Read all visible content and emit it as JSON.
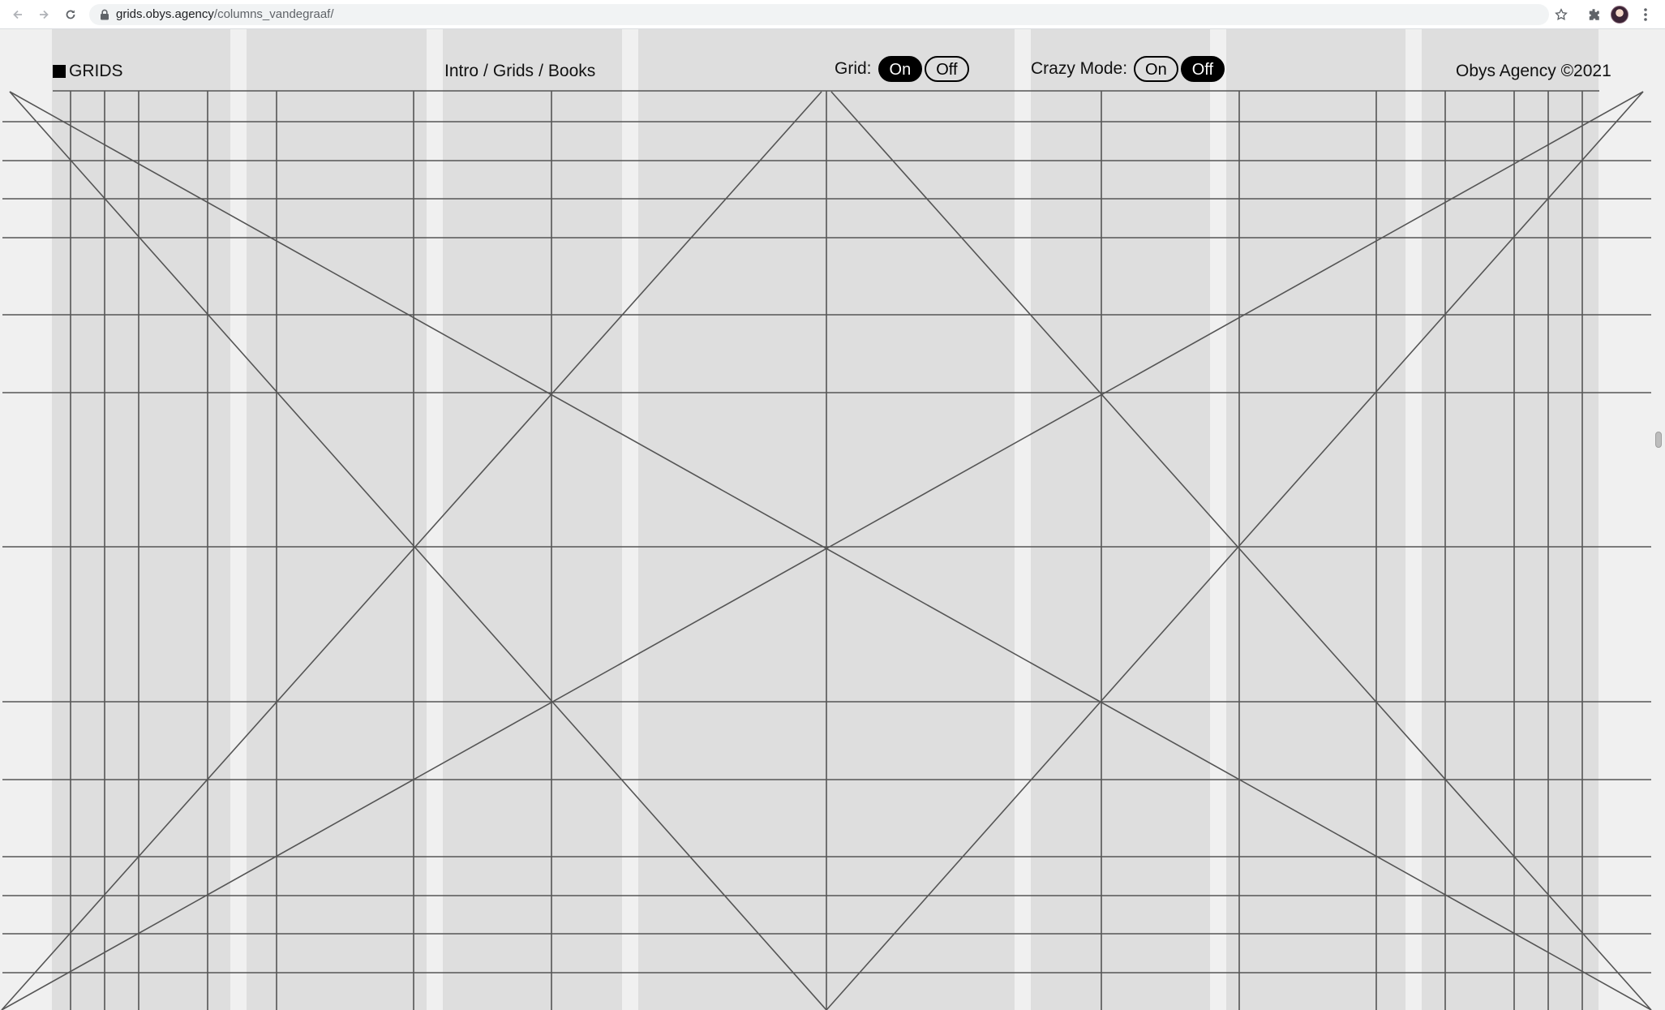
{
  "browser": {
    "url_host": "grids.obys.agency",
    "url_path": "/columns_vandegraaf/",
    "icons": [
      "back-arrow-icon",
      "forward-arrow-icon",
      "reload-icon",
      "lock-icon",
      "star-icon",
      "extensions-icon",
      "avatar",
      "more-menu-icon"
    ]
  },
  "header": {
    "logo_text": "GRIDS",
    "breadcrumb": [
      "Intro",
      "Grids",
      "Books"
    ],
    "breadcrumb_separator": "/",
    "grid_toggle": {
      "label": "Grid:",
      "on": "On",
      "off": "Off",
      "selected": "On"
    },
    "crazy_toggle": {
      "label": "Crazy Mode:",
      "on": "On",
      "off": "Off",
      "selected": "Off"
    },
    "copyright": "Obys Agency ©2021"
  },
  "colors": {
    "page_background": "#f0f0f0",
    "column_fill": "#dedede",
    "grid_line": "#555555",
    "toggle_active": "#000000"
  }
}
